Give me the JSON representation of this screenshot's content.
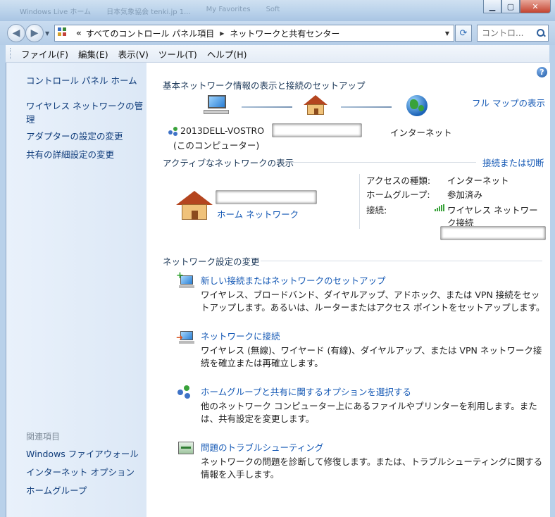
{
  "background_tabs": [
    "Windows Live ホーム",
    "日本気象協会 tenki.jp 1...",
    "My Favorites",
    "Soft"
  ],
  "address_bar": {
    "overflow": "«",
    "crumbs": [
      "すべてのコントロール パネル項目",
      "ネットワークと共有センター"
    ]
  },
  "search": {
    "placeholder": "コントロ..."
  },
  "menu": [
    "ファイル(F)",
    "編集(E)",
    "表示(V)",
    "ツール(T)",
    "ヘルプ(H)"
  ],
  "sidebar": {
    "home": "コントロール パネル ホーム",
    "links": [
      "ワイヤレス ネットワークの管理",
      "アダプターの設定の変更",
      "共有の詳細設定の変更"
    ],
    "see_also_header": "関連項目",
    "see_also": [
      "Windows ファイアウォール",
      "インターネット オプション",
      "ホームグループ"
    ]
  },
  "main": {
    "heading": "基本ネットワーク情報の表示と接続のセットアップ",
    "full_map": "フル マップの表示",
    "computer_name": "2013DELL-VOSTRO",
    "computer_sub": "(このコンピューター)",
    "internet_label": "インターネット",
    "active_heading": "アクティブなネットワークの表示",
    "connect_disconnect": "接続または切断",
    "network_type": "ホーム ネットワーク",
    "access_type_label": "アクセスの種類:",
    "access_type_value": "インターネット",
    "homegroup_label": "ホームグループ:",
    "homegroup_value": "参加済み",
    "connection_label": "接続:",
    "connection_value_1": "ワイヤレス ネットワー",
    "connection_value_2": "ク接続",
    "change_heading": "ネットワーク設定の変更",
    "tasks": [
      {
        "title": "新しい接続またはネットワークのセットアップ",
        "desc": "ワイヤレス、ブロードバンド、ダイヤルアップ、アドホック、または VPN 接続をセットアップします。あるいは、ルーターまたはアクセス ポイントをセットアップします。"
      },
      {
        "title": "ネットワークに接続",
        "desc": "ワイヤレス (無線)、ワイヤード (有線)、ダイヤルアップ、または VPN ネットワーク接続を確立または再確立します。"
      },
      {
        "title": "ホームグループと共有に関するオプションを選択する",
        "desc": "他のネットワーク コンピューター上にあるファイルやプリンターを利用します。または、共有設定を変更します。"
      },
      {
        "title": "問題のトラブルシューティング",
        "desc": "ネットワークの問題を診断して修復します。または、トラブルシューティングに関する情報を入手します。"
      }
    ]
  },
  "icons": {
    "help": "?",
    "back": "◀",
    "forward": "▶",
    "refresh": "⟳",
    "dropdown": "▼",
    "crumb_arrow": "▶",
    "minimize": "▁",
    "maximize": "▢",
    "close": "✕"
  },
  "colors": {
    "link": "#1559b5",
    "sidebar_link": "#0e3b7a",
    "chrome": "#b9d1ea"
  }
}
